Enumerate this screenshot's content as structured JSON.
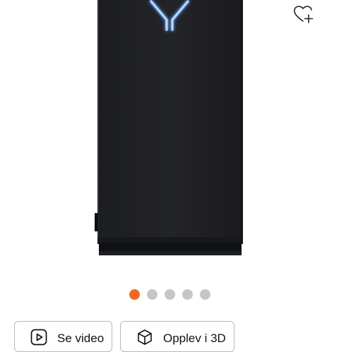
{
  "gallery": {
    "image_count": 5,
    "active_index": 0,
    "accent_color": "#ee6a1e",
    "inactive_color": "#c6c6c6"
  },
  "wishlist": {
    "icon": "heart-plus-icon"
  },
  "actions": {
    "video_label": "Se video",
    "video_icon": "play-square-icon",
    "view3d_label": "Opplev i 3D",
    "view3d_icon": "cube-icon"
  }
}
